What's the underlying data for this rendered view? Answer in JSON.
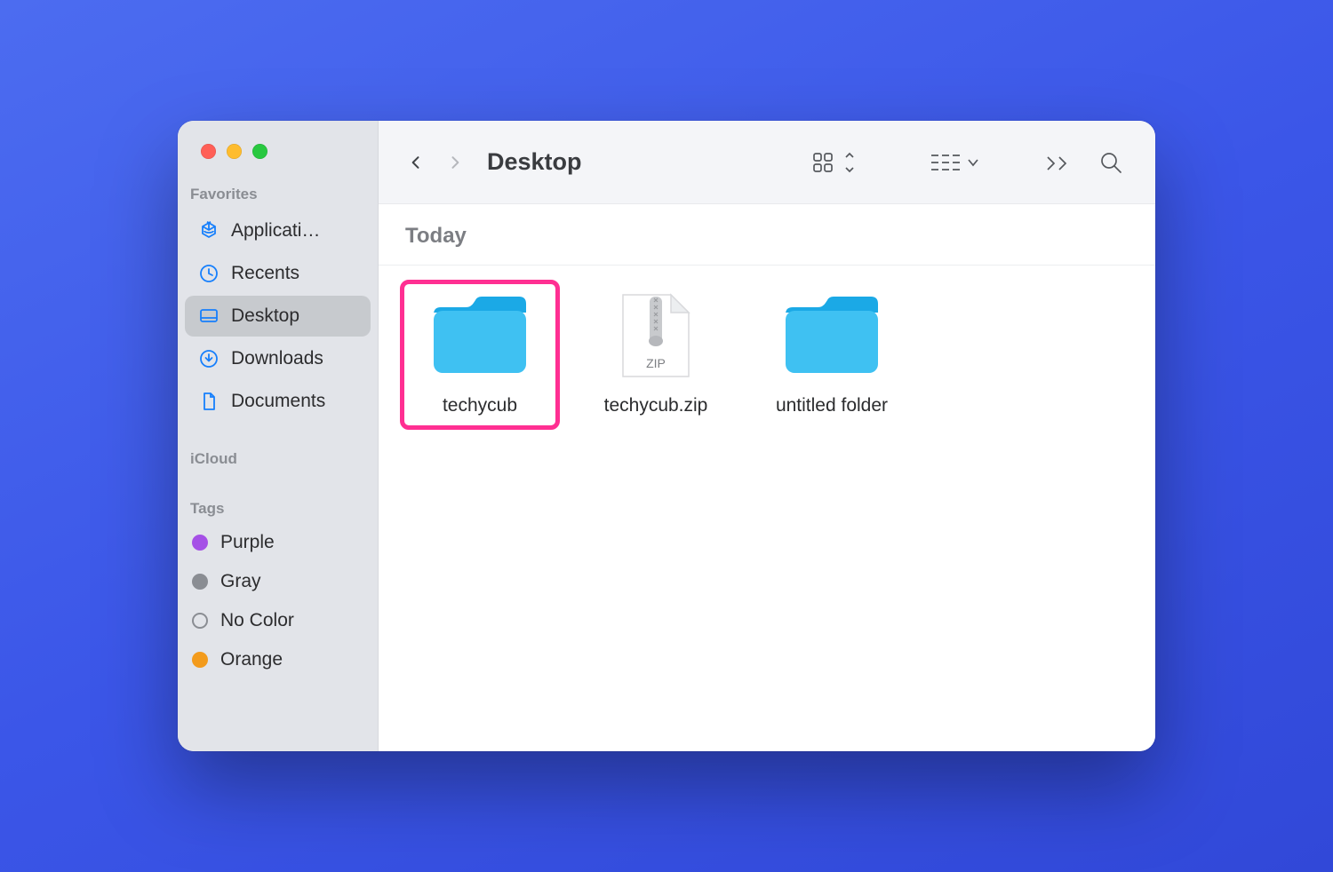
{
  "window_title": "Desktop",
  "sidebar": {
    "sections": {
      "favorites_label": "Favorites",
      "icloud_label": "iCloud",
      "tags_label": "Tags"
    },
    "favorites": [
      {
        "label": "Applicati…",
        "icon": "applications-icon",
        "selected": false
      },
      {
        "label": "Recents",
        "icon": "clock-icon",
        "selected": false
      },
      {
        "label": "Desktop",
        "icon": "desktop-icon",
        "selected": true
      },
      {
        "label": "Downloads",
        "icon": "download-icon",
        "selected": false
      },
      {
        "label": "Documents",
        "icon": "document-icon",
        "selected": false
      }
    ],
    "tags": [
      {
        "label": "Purple",
        "color": "#a550e6"
      },
      {
        "label": "Gray",
        "color": "#8a8d93"
      },
      {
        "label": "No Color",
        "color": "outline"
      },
      {
        "label": "Orange",
        "color": "#f39b1c"
      }
    ]
  },
  "content": {
    "group_header": "Today",
    "items": [
      {
        "name": "techycub",
        "type": "folder",
        "highlighted": true
      },
      {
        "name": "techycub.zip",
        "type": "zip",
        "highlighted": false
      },
      {
        "name": "untitled folder",
        "type": "folder",
        "highlighted": false
      }
    ]
  },
  "colors": {
    "folder_fill": "#3fc1f2",
    "folder_tab": "#1ba9e6",
    "highlight_border": "#ff2f92"
  }
}
